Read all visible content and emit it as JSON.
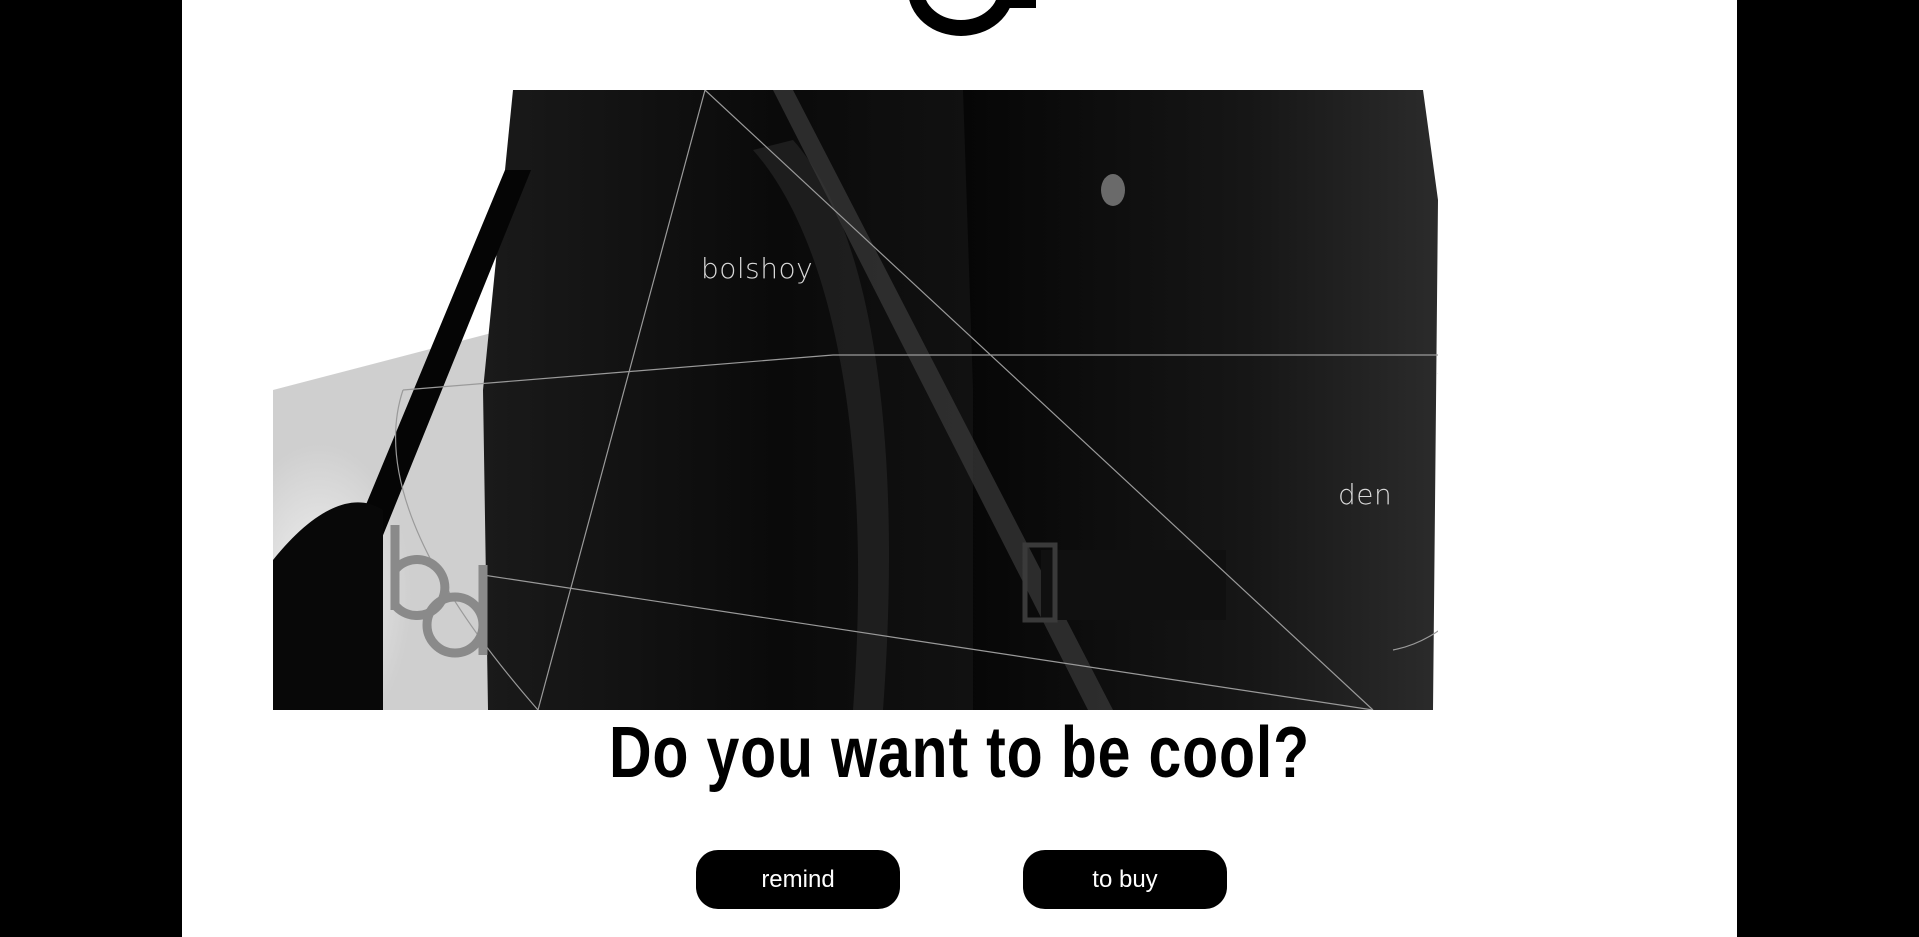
{
  "hero": {
    "label_left": "bolshoy",
    "label_right": "den",
    "logo_icon": "bd-monogram-icon"
  },
  "top_logo_icon": "brand-logo-icon",
  "headline": "Do you want to be cool?",
  "buttons": {
    "remind": "remind",
    "buy": "to buy"
  },
  "colors": {
    "background_outer": "#000000",
    "page": "#ffffff",
    "button_bg": "#000000",
    "button_text": "#ffffff",
    "hero_lines": "#9a9a9a"
  }
}
